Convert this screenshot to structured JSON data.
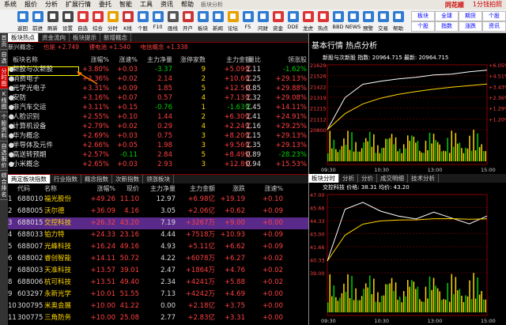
{
  "menu": {
    "items": [
      "系统",
      "报价",
      "分析",
      "扩展行情",
      "委托",
      "智能",
      "工具",
      "资讯",
      "帮助"
    ],
    "window_title": "板块分析",
    "logo": "同花顺",
    "corner": "1分钱拍照"
  },
  "toolbar": {
    "buttons": [
      {
        "label": "返回",
        "color": "#2e7bd1"
      },
      {
        "label": "前进",
        "color": "#2e7bd1"
      },
      {
        "label": "刷新",
        "color": "#444"
      },
      {
        "label": "设置",
        "color": "#444"
      },
      {
        "label": "自选",
        "color": "#d33"
      },
      {
        "label": "综合",
        "color": "#d33"
      },
      {
        "label": "分时",
        "color": "#e6a100"
      },
      {
        "label": "K线",
        "color": "#c33"
      },
      {
        "label": "个股",
        "color": "#2e7bd1"
      },
      {
        "label": "F10",
        "color": "#2e7bd1"
      },
      {
        "label": "画线",
        "color": "#555"
      },
      {
        "label": "开户",
        "color": "#c33"
      },
      {
        "label": "板块",
        "color": "#2e7bd1"
      },
      {
        "label": "新闻",
        "color": "#2e7bd1"
      },
      {
        "label": "论坛",
        "color": "#e6a100"
      },
      {
        "label": "F5",
        "color": "#2e7bd1"
      },
      {
        "label": "问财",
        "color": "#2e7bd1"
      },
      {
        "label": "资金",
        "color": "#d33"
      },
      {
        "label": "DDE",
        "color": "#2e7bd1"
      },
      {
        "label": "龙虎",
        "color": "#d33"
      },
      {
        "label": "热点",
        "color": "#d33"
      },
      {
        "label": "BBD",
        "color": "#2e7bd1"
      },
      {
        "label": "NEWS",
        "color": "#2e7bd1"
      },
      {
        "label": "预警",
        "color": "#2e7bd1"
      },
      {
        "label": "交易",
        "color": "#2e7bd1"
      },
      {
        "label": "帮助",
        "color": "#2e7bd1"
      }
    ],
    "right_buttons": [
      "板块",
      "全球",
      "期货",
      "个股",
      "个股",
      "指数",
      "涨跌",
      "资讯"
    ]
  },
  "vtabs": [
    "首页",
    "自选",
    "分时图",
    "K线图",
    "个股资料",
    "自选报价",
    "综合排名"
  ],
  "tabs_top": [
    "板块热点",
    "资金流向",
    "板块提示",
    "新增概念"
  ],
  "concept": {
    "label": "新兴概念:",
    "v1": "也是 +2.749",
    "v2": "锂电池 +1.540",
    "v3": "电信概念 +1.338"
  },
  "table1": {
    "headers": [
      "板块名称",
      "涨幅%",
      "涨速%",
      "主力净量",
      "涨停家数",
      "主力金额",
      "量比",
      "领涨股"
    ],
    "rows": [
      {
        "name": "新股与次新股",
        "zf": "+3.80%",
        "zs": "+0.03",
        "jl": "-3.37",
        "jt": "9",
        "je": "+5.09亿",
        "lb": "1.11",
        "lz": "-1.62%"
      },
      {
        "name": "消费电子",
        "zf": "+3.36%",
        "zs": "+0.02",
        "jl": "2.14",
        "jt": "2",
        "je": "+10.6亿",
        "lb": "1.25",
        "lz": "+29.13%"
      },
      {
        "name": "光学光电子",
        "zf": "+3.31%",
        "zs": "+0.09",
        "jl": "1.85",
        "jt": "5",
        "je": "+12.5亿",
        "lb": "0.85",
        "lz": "+29.88%"
      },
      {
        "name": "安防",
        "zf": "+3.16%",
        "zs": "+0.07",
        "jl": "0.57",
        "jt": "4",
        "je": "+7.13亿",
        "lb": "1.32",
        "lz": "+29.08%"
      },
      {
        "name": "非汽车交运",
        "zf": "+3.11%",
        "zs": "+0.15",
        "jl": "-0.76",
        "jt": "1",
        "je": "-1.63亿",
        "lb": "1.45",
        "lz": "+14.11%"
      },
      {
        "name": "人脸识别",
        "zf": "+2.55%",
        "zs": "+0.10",
        "jl": "1.44",
        "jt": "2",
        "je": "+6.30亿",
        "lb": "1.41",
        "lz": "+24.91%"
      },
      {
        "name": "计算机设备",
        "zf": "+2.79%",
        "zs": "+0.02",
        "jl": "0.29",
        "jt": "4",
        "je": "+2.24亿",
        "lb": "1.16",
        "lz": "+29.25%"
      },
      {
        "name": "华为概念",
        "zf": "+2.69%",
        "zs": "+0.03",
        "jl": "0.75",
        "jt": "3",
        "je": "+8.20亿",
        "lb": "1.15",
        "lz": "+29.13%"
      },
      {
        "name": "半导体及元件",
        "zf": "+2.66%",
        "zs": "+0.05",
        "jl": "1.98",
        "jt": "3",
        "je": "+9.56亿",
        "lb": "1.35",
        "lz": "+29.13%"
      },
      {
        "name": "高送转预期",
        "zf": "+2.57%",
        "zs": "-0.11",
        "jl": "2.84",
        "jt": "5",
        "je": "+8.49亿",
        "lb": "0.89",
        "lz": "-28.23%"
      },
      {
        "name": "小米概念",
        "zf": "+2.65%",
        "zs": "+0.03",
        "jl": "2.93",
        "jt": "3",
        "je": "+12.8亿",
        "lb": "0.94",
        "lz": "+15.53%"
      }
    ]
  },
  "tabs_bottom": [
    "两定板块指数",
    "行业指数",
    "概念指数",
    "次新指数",
    "领涨板块"
  ],
  "table2": {
    "headers": [
      "代码",
      "名称",
      "涨幅%",
      "现价",
      "主力净量",
      "主力金额",
      "涨跌",
      "涨速%"
    ],
    "rows": [
      {
        "n": "1",
        "code": "688010",
        "name": "福光股份",
        "zf": "+49.26",
        "xj": "11.10",
        "jl": "12.97",
        "je": "+6.98亿",
        "zd": "+19.19",
        "zs": "+0.10"
      },
      {
        "n": "2",
        "code": "688005",
        "name": "沃尔德",
        "zf": "+36.09",
        "xj": "4.16",
        "jl": "3.05",
        "je": "+2.06亿",
        "zd": "+0.62",
        "zs": "+0.09"
      },
      {
        "n": "3",
        "code": "688015",
        "name": "交控科技",
        "zf": "+26.32",
        "xj": "43.20",
        "jl": "7.19",
        "je": "+3267万",
        "zd": "+9.00",
        "zs": "+0.00"
      },
      {
        "n": "4",
        "code": "688033",
        "name": "铂力特",
        "zf": "+24.33",
        "xj": "23.16",
        "jl": "4.44",
        "je": "+7518万",
        "zd": "+10.93",
        "zs": "+0.09"
      },
      {
        "n": "5",
        "code": "688007",
        "name": "光峰科技",
        "zf": "+16.24",
        "xj": "49.16",
        "jl": "4.93",
        "je": "+5.11亿",
        "zd": "+6.62",
        "zs": "+0.09"
      },
      {
        "n": "6",
        "code": "688002",
        "name": "睿创智能",
        "zf": "+14.11",
        "xj": "50.72",
        "jl": "4.22",
        "je": "+6078万",
        "zd": "+6.27",
        "zs": "+0.02"
      },
      {
        "n": "7",
        "code": "688003",
        "name": "天准科技",
        "zf": "+13.57",
        "xj": "39.01",
        "jl": "2.47",
        "je": "+1864万",
        "zd": "+4.76",
        "zs": "+0.02"
      },
      {
        "n": "8",
        "code": "688006",
        "name": "杭可科技",
        "zf": "+13.51",
        "xj": "49.40",
        "jl": "2.34",
        "je": "+4241万",
        "zd": "+5.88",
        "zs": "+0.02"
      },
      {
        "n": "9",
        "code": "603297",
        "name": "永新光学",
        "zf": "+10.01",
        "xj": "51.55",
        "jl": "7.13",
        "je": "+4242万",
        "zd": "+4.69",
        "zs": "+0.00"
      },
      {
        "n": "10",
        "code": "300795",
        "name": "米奥会展",
        "zf": "+10.00",
        "xj": "41.22",
        "jl": "0.00",
        "je": "+2.18亿",
        "zd": "+3.75",
        "zs": "+0.00"
      },
      {
        "n": "11",
        "code": "300775",
        "name": "三角防务",
        "zf": "+10.00",
        "xj": "25.08",
        "jl": "2.77",
        "je": "+2.83亿",
        "zd": "+3.31",
        "zs": "+0.00"
      }
    ]
  },
  "chart_panel": {
    "title": "基本行情  热点分析",
    "info_top": "新股与次新股  指数: 20964.715  最新: 20964.715",
    "bottom_tabs": [
      "板块分时",
      "分析",
      "分价",
      "成交明细",
      "技术分析"
    ],
    "info_bottom": "交控科技  价格: 38.31  均价: 43.20",
    "top_yaxis": [
      "21629",
      "21526",
      "21422",
      "21319",
      "21215",
      "21112",
      "20800"
    ],
    "top_pct": [
      "+6.05%",
      "+4.51%",
      "+3.43%",
      "+2.36%",
      "+1.29%",
      "+1.20%",
      ""
    ],
    "xaxis": [
      "09:30",
      "10:30",
      "13:00",
      "15:00"
    ],
    "bottom_yaxis": [
      "47.00",
      "45.66",
      "44.33",
      "43.00",
      "41.66",
      "40.33",
      "39.00"
    ]
  },
  "chart_data": [
    {
      "type": "line",
      "title": "新股与次新股",
      "x": [
        "09:30",
        "10:00",
        "10:30",
        "11:00",
        "11:30",
        "13:00",
        "13:30",
        "14:00",
        "14:30",
        "15:00"
      ],
      "series": [
        {
          "name": "指数",
          "values": [
            20800,
            21210,
            21380,
            21420,
            21450,
            21470,
            21500,
            21510,
            21540,
            21560
          ]
        }
      ],
      "ylim": [
        20800,
        21629
      ]
    },
    {
      "type": "line",
      "title": "交控科技",
      "x": [
        "09:30",
        "10:00",
        "10:30",
        "11:00",
        "11:30",
        "13:00",
        "13:30",
        "14:00",
        "14:30",
        "15:00"
      ],
      "series": [
        {
          "name": "价格",
          "values": [
            40.2,
            45.5,
            46.2,
            45.3,
            44.8,
            44.5,
            45.2,
            44.6,
            44.0,
            44.8
          ]
        }
      ],
      "ylim": [
        39.0,
        47.0
      ]
    }
  ]
}
